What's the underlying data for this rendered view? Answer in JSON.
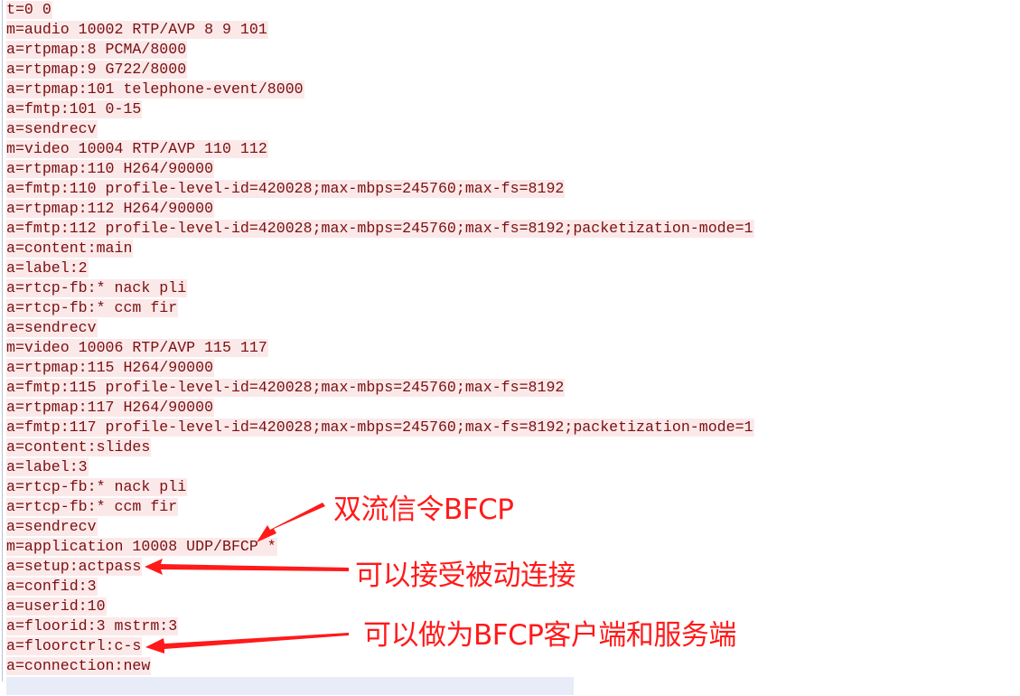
{
  "document": {
    "lines": [
      "t=0 0",
      "m=audio 10002 RTP/AVP 8 9 101",
      "a=rtpmap:8 PCMA/8000",
      "a=rtpmap:9 G722/8000",
      "a=rtpmap:101 telephone-event/8000",
      "a=fmtp:101 0-15",
      "a=sendrecv",
      "m=video 10004 RTP/AVP 110 112",
      "a=rtpmap:110 H264/90000",
      "a=fmtp:110 profile-level-id=420028;max-mbps=245760;max-fs=8192",
      "a=rtpmap:112 H264/90000",
      "a=fmtp:112 profile-level-id=420028;max-mbps=245760;max-fs=8192;packetization-mode=1",
      "a=content:main",
      "a=label:2",
      "a=rtcp-fb:* nack pli",
      "a=rtcp-fb:* ccm fir",
      "a=sendrecv",
      "m=video 10006 RTP/AVP 115 117",
      "a=rtpmap:115 H264/90000",
      "a=fmtp:115 profile-level-id=420028;max-mbps=245760;max-fs=8192",
      "a=rtpmap:117 H264/90000",
      "a=fmtp:117 profile-level-id=420028;max-mbps=245760;max-fs=8192;packetization-mode=1",
      "a=content:slides",
      "a=label:3",
      "a=rtcp-fb:* nack pli",
      "a=rtcp-fb:* ccm fir",
      "a=sendrecv",
      "m=application 10008 UDP/BFCP *",
      "a=setup:actpass",
      "a=confid:3",
      "a=userid:10",
      "a=floorid:3 mstrm:3",
      "a=floorctrl:c-s",
      "a=connection:new"
    ],
    "partial_line": "                                                               "
  },
  "annotations": [
    {
      "text": "双流信令BFCP",
      "target_line": "m=application 10008 UDP/BFCP *"
    },
    {
      "text": "可以接受被动连接",
      "target_line": "a=setup:actpass"
    },
    {
      "text": "可以做为BFCP客户端和服务端",
      "target_line": "a=floorctrl:c-s"
    }
  ],
  "colors": {
    "text": "#7a1010",
    "line_highlight": "#fbe9ea",
    "annotation": "#ff1a1a"
  }
}
